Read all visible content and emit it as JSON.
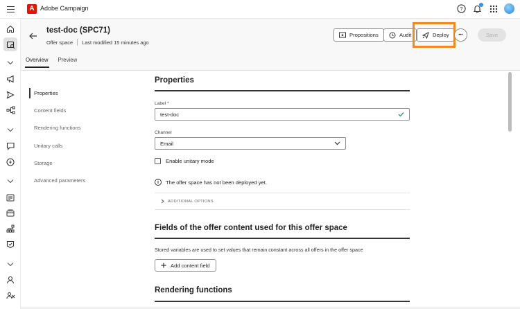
{
  "app": {
    "title": "Adobe Campaign",
    "logo_icon": "adobe-logo-icon",
    "brand_color": "#eb1000"
  },
  "topbar": {
    "icons": [
      "help-icon",
      "bell-icon",
      "apps-grid-icon",
      "avatar"
    ]
  },
  "rail": {
    "items": [
      "home-icon",
      "offer-search-icon",
      "chevron-down-icon",
      "megaphone-icon",
      "send-icon",
      "workflow-icon",
      "chevron-down-icon",
      "chat-icon",
      "lightning-icon",
      "chevron-down-icon",
      "content-icon",
      "cards-icon",
      "hierarchy-icon",
      "badge-icon",
      "chevron-down-icon",
      "user-icon",
      "audience-icon"
    ]
  },
  "header": {
    "title": "test-doc (SPC71)",
    "subtitle_type": "Offer space",
    "subtitle_modified": "Last modified 15 minutes ago",
    "buttons": {
      "propositions": "Propositions",
      "audit": "Audit",
      "deploy": "Deploy",
      "more": "•••",
      "save": "Save"
    },
    "highlight_color": "#f08a1c",
    "tabs": [
      {
        "label": "Overview",
        "active": true
      },
      {
        "label": "Preview",
        "active": false
      }
    ]
  },
  "subnav": {
    "items": [
      {
        "label": "Properties",
        "active": true
      },
      {
        "label": "Content fields",
        "active": false
      },
      {
        "label": "Rendering functions",
        "active": false
      },
      {
        "label": "Unitary calls",
        "active": false
      },
      {
        "label": "Storage",
        "active": false
      },
      {
        "label": "Advanced parameters",
        "active": false
      }
    ]
  },
  "properties": {
    "title": "Properties",
    "label_field": {
      "label": "Label",
      "required_mark": "*",
      "value": "test-doc"
    },
    "channel_field": {
      "label": "Channel",
      "value": "Email"
    },
    "unitary_mode": {
      "label": "Enable unitary mode",
      "checked": false
    },
    "info_message": "The offer space has not been deployed yet.",
    "additional_options": "ADDITIONAL OPTIONS"
  },
  "fields_section": {
    "title": "Fields of the offer content used for this offer space",
    "description": "Stored variables are used to set values that remain constant across all offers in the offer space",
    "add_button": "Add content field"
  },
  "rendering_section": {
    "title": "Rendering functions"
  }
}
